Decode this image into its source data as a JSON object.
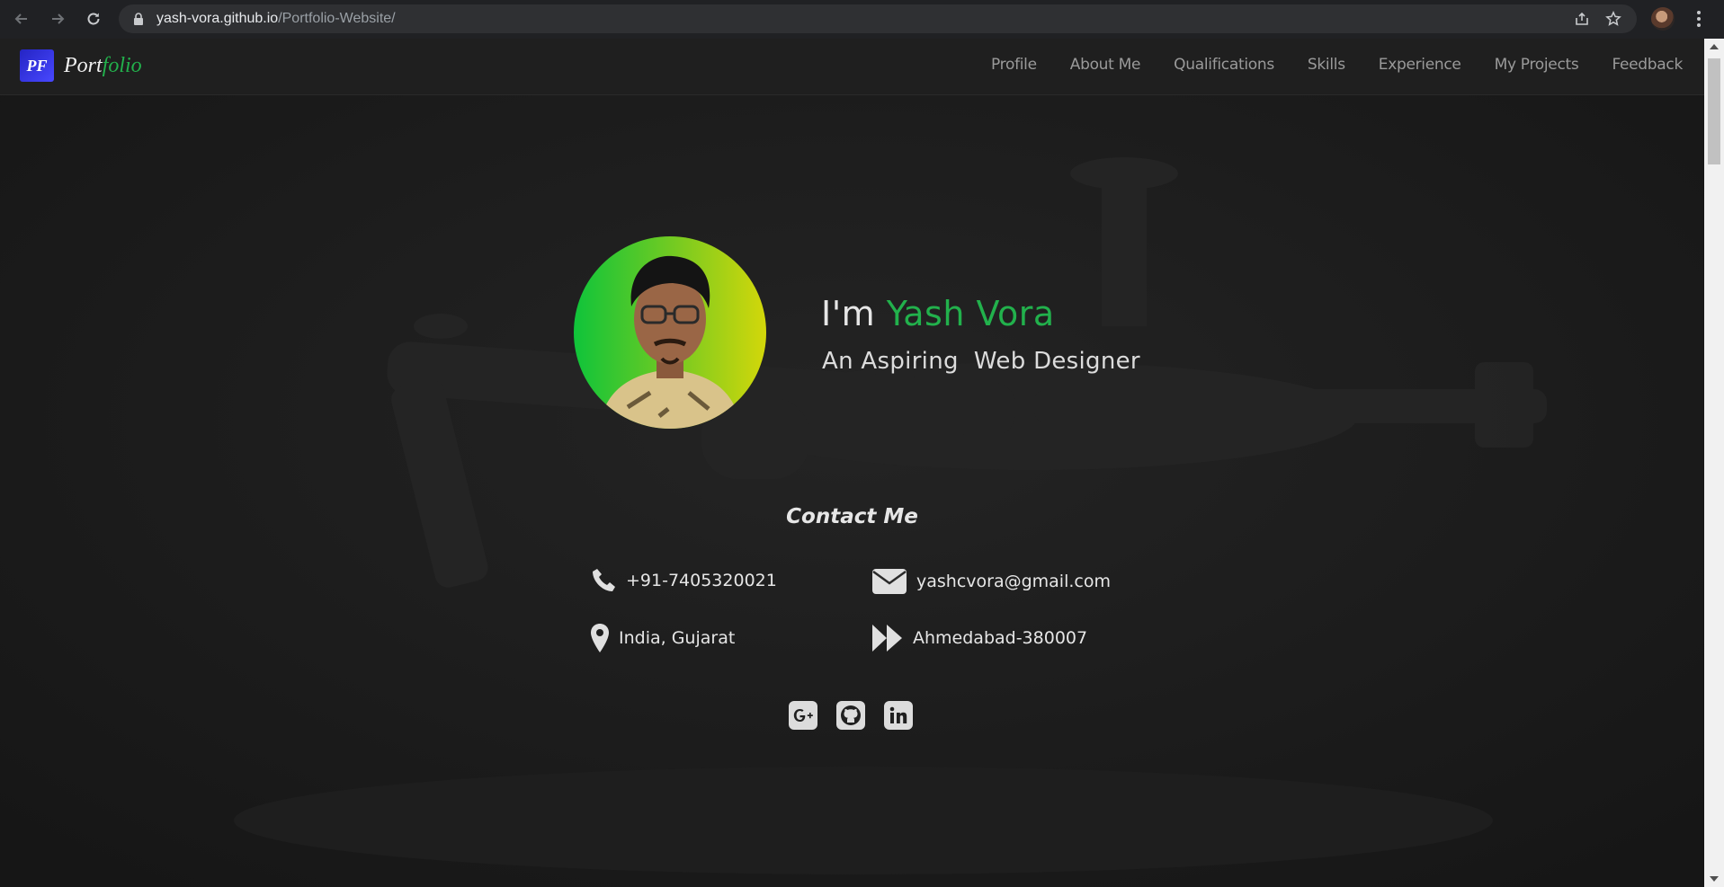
{
  "browser": {
    "url_host": "yash-vora.github.io",
    "url_path": "/Portfolio-Website/"
  },
  "brand": {
    "logo_text": "PF",
    "name_part1": "Port",
    "name_part2": "folio",
    "accent_color": "#22b14c"
  },
  "nav": {
    "items": [
      {
        "label": "Profile"
      },
      {
        "label": "About Me"
      },
      {
        "label": "Qualifications"
      },
      {
        "label": "Skills"
      },
      {
        "label": "Experience"
      },
      {
        "label": "My Projects"
      },
      {
        "label": "Feedback"
      }
    ]
  },
  "hero": {
    "greeting": "I'm ",
    "name": "Yash Vora",
    "role": "An Aspiring  Web Designer"
  },
  "contact": {
    "title": "Contact Me",
    "phone": "+91-7405320021",
    "email": "yashcvora@gmail.com",
    "location": "India, Gujarat",
    "city": "Ahmedabad-380007"
  },
  "socials": [
    {
      "name": "google-plus-icon"
    },
    {
      "name": "github-icon"
    },
    {
      "name": "linkedin-icon"
    }
  ]
}
